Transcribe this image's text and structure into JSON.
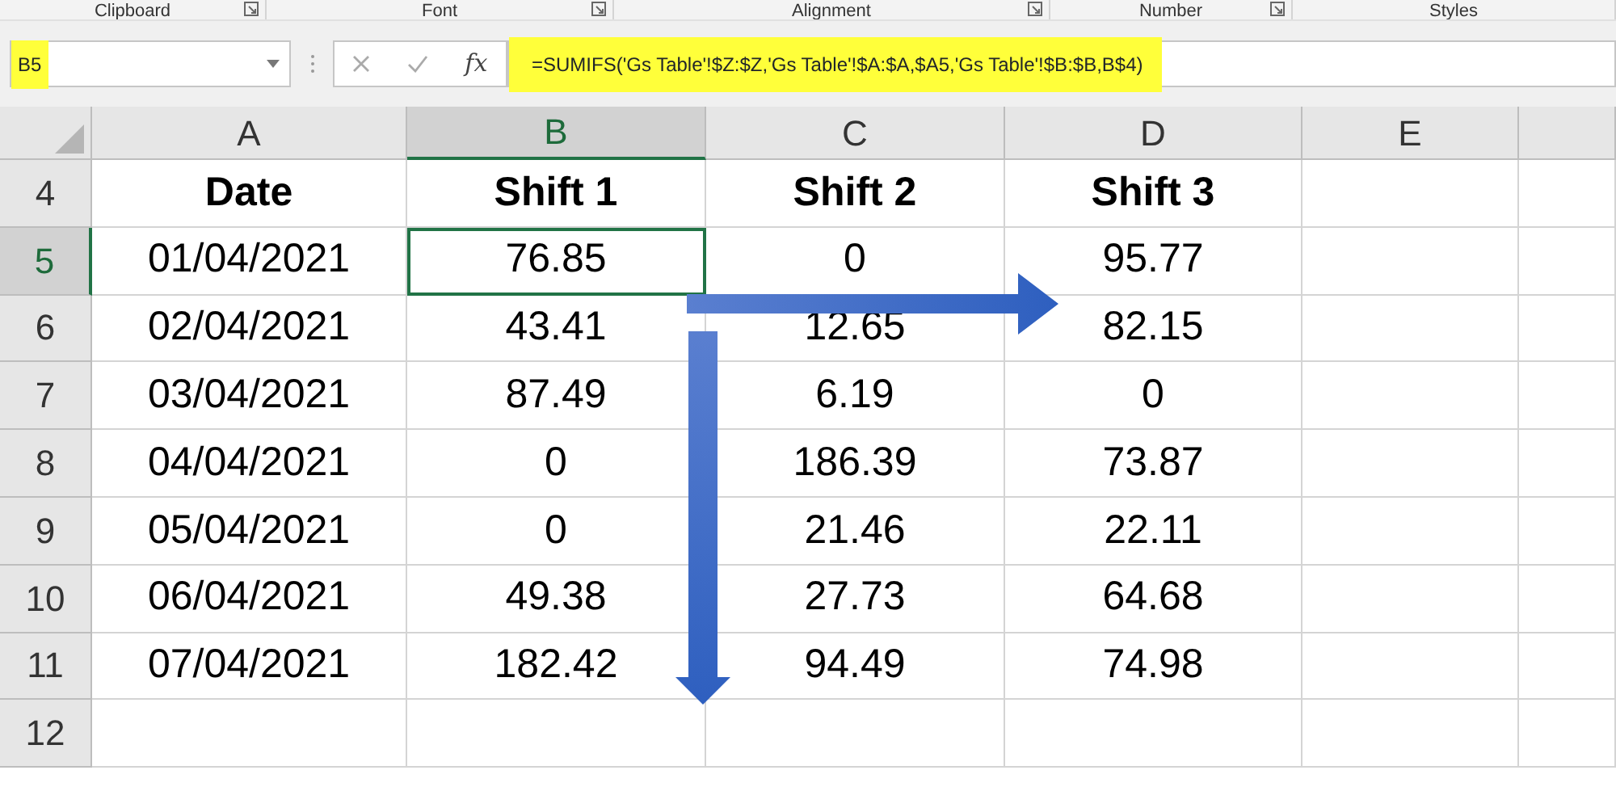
{
  "ribbon_groups": [
    {
      "label": "Clipboard",
      "launcher": true
    },
    {
      "label": "Font",
      "launcher": true
    },
    {
      "label": "Alignment",
      "launcher": true
    },
    {
      "label": "Number",
      "launcher": true
    },
    {
      "label": "Styles",
      "launcher": false
    }
  ],
  "name_box": {
    "value": "B5",
    "highlighted": true
  },
  "formula_bar": {
    "fx": "fx",
    "value": "=SUMIFS('Gs Table'!$Z:$Z,'Gs Table'!$A:$A,$A5,'Gs Table'!$B:$B,B$4)",
    "highlighted": true
  },
  "columns": [
    {
      "label": "A",
      "selected": false
    },
    {
      "label": "B",
      "selected": true
    },
    {
      "label": "C",
      "selected": false
    },
    {
      "label": "D",
      "selected": false
    },
    {
      "label": "E",
      "selected": false
    }
  ],
  "rows": [
    {
      "number": "4",
      "selected": false,
      "kind": "header",
      "cells": [
        {
          "text": "Date",
          "selected": false
        },
        {
          "text": "Shift 1",
          "selected": false
        },
        {
          "text": "Shift 2",
          "selected": false
        },
        {
          "text": "Shift 3",
          "selected": false
        }
      ]
    },
    {
      "number": "5",
      "selected": true,
      "kind": "data",
      "cells": [
        {
          "text": "01/04/2021",
          "selected": false
        },
        {
          "text": "76.85",
          "selected": true
        },
        {
          "text": "0",
          "selected": false
        },
        {
          "text": "95.77",
          "selected": false
        }
      ]
    },
    {
      "number": "6",
      "selected": false,
      "kind": "data",
      "cells": [
        {
          "text": "02/04/2021",
          "selected": false
        },
        {
          "text": "43.41",
          "selected": false
        },
        {
          "text": "12.65",
          "selected": false
        },
        {
          "text": "82.15",
          "selected": false
        }
      ]
    },
    {
      "number": "7",
      "selected": false,
      "kind": "data",
      "cells": [
        {
          "text": "03/04/2021",
          "selected": false
        },
        {
          "text": "87.49",
          "selected": false
        },
        {
          "text": "6.19",
          "selected": false
        },
        {
          "text": "0",
          "selected": false
        }
      ]
    },
    {
      "number": "8",
      "selected": false,
      "kind": "data",
      "cells": [
        {
          "text": "04/04/2021",
          "selected": false
        },
        {
          "text": "0",
          "selected": false
        },
        {
          "text": "186.39",
          "selected": false
        },
        {
          "text": "73.87",
          "selected": false
        }
      ]
    },
    {
      "number": "9",
      "selected": false,
      "kind": "data",
      "cells": [
        {
          "text": "05/04/2021",
          "selected": false
        },
        {
          "text": "0",
          "selected": false
        },
        {
          "text": "21.46",
          "selected": false
        },
        {
          "text": "22.11",
          "selected": false
        }
      ]
    },
    {
      "number": "10",
      "selected": false,
      "kind": "data",
      "cells": [
        {
          "text": "06/04/2021",
          "selected": false
        },
        {
          "text": "49.38",
          "selected": false
        },
        {
          "text": "27.73",
          "selected": false
        },
        {
          "text": "64.68",
          "selected": false
        }
      ]
    },
    {
      "number": "11",
      "selected": false,
      "kind": "data",
      "cells": [
        {
          "text": "07/04/2021",
          "selected": false
        },
        {
          "text": "182.42",
          "selected": false
        },
        {
          "text": "94.49",
          "selected": false
        },
        {
          "text": "74.98",
          "selected": false
        }
      ]
    },
    {
      "number": "12",
      "selected": false
    }
  ]
}
